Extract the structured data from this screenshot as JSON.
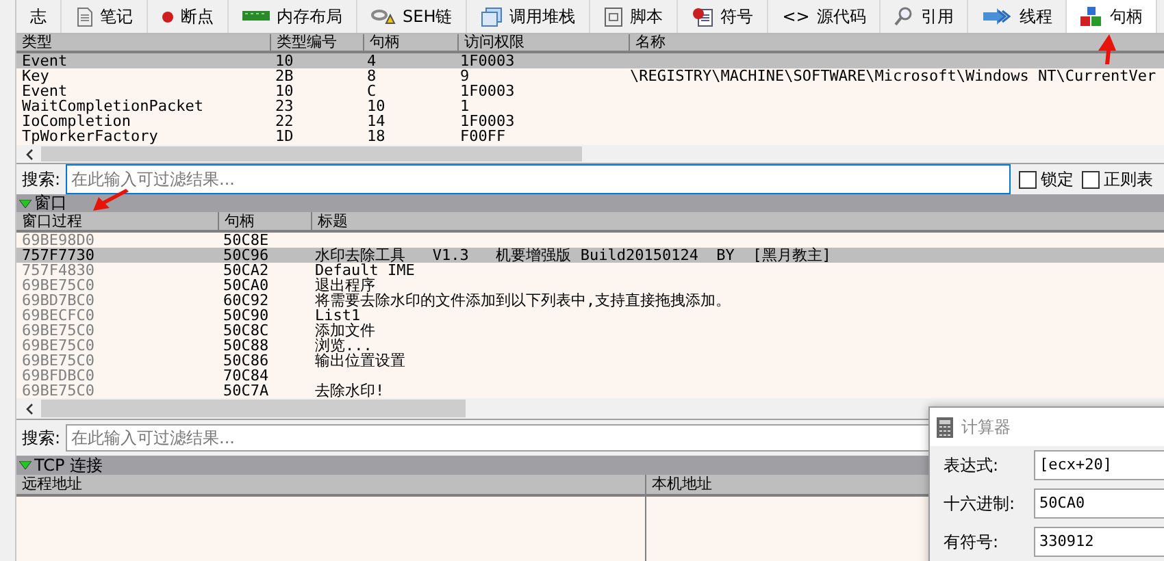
{
  "tabs": [
    {
      "label": "志",
      "kind": "none",
      "selected": false
    },
    {
      "label": "笔记",
      "kind": "note",
      "selected": false
    },
    {
      "label": "断点",
      "kind": "dot",
      "selected": false
    },
    {
      "label": "内存布局",
      "kind": "ram",
      "selected": false
    },
    {
      "label": "SEH链",
      "kind": "chain",
      "selected": false
    },
    {
      "label": "调用堆栈",
      "kind": "stack",
      "selected": false
    },
    {
      "label": "脚本",
      "kind": "script",
      "selected": false
    },
    {
      "label": "符号",
      "kind": "symbol",
      "selected": false
    },
    {
      "label": "<>",
      "kind": "text",
      "selected": false,
      "text": "源代码"
    },
    {
      "label": "引用",
      "kind": "search",
      "selected": false
    },
    {
      "label": "线程",
      "kind": "threads",
      "selected": false
    },
    {
      "label": "句柄",
      "kind": "blocks",
      "selected": true
    }
  ],
  "handles": {
    "columns": [
      "类型",
      "类型编号",
      "句柄",
      "访问权限",
      "名称"
    ],
    "rows": [
      {
        "cells": [
          "Event",
          "10",
          "4",
          "1F0003",
          ""
        ],
        "selected": true
      },
      {
        "cells": [
          "Key",
          "2B",
          "8",
          "9",
          "\\REGISTRY\\MACHINE\\SOFTWARE\\Microsoft\\Windows NT\\CurrentVer"
        ],
        "selected": false
      },
      {
        "cells": [
          "Event",
          "10",
          "C",
          "1F0003",
          ""
        ],
        "selected": false
      },
      {
        "cells": [
          "WaitCompletionPacket",
          "23",
          "10",
          "1",
          ""
        ],
        "selected": false
      },
      {
        "cells": [
          "IoCompletion",
          "22",
          "14",
          "1F0003",
          ""
        ],
        "selected": false
      },
      {
        "cells": [
          "TpWorkerFactory",
          "1D",
          "18",
          "F00FF",
          ""
        ],
        "selected": false
      }
    ]
  },
  "search_1": {
    "label": "搜索:",
    "placeholder": "在此输入可过滤结果...",
    "options": [
      {
        "label": "锁定",
        "checked": false
      },
      {
        "label": "正则表",
        "checked": false
      }
    ]
  },
  "windows": {
    "title": "窗口",
    "expanded": true,
    "columns": [
      "窗口过程",
      "句柄",
      "标题"
    ],
    "rows": [
      {
        "cells": [
          "69BE98D0",
          "50C8E",
          ""
        ],
        "selected": false
      },
      {
        "cells": [
          "757F7730",
          "50C96",
          "水印去除工具   V1.3   机要增强版 Build20150124  BY  [黑月教主]"
        ],
        "selected": true
      },
      {
        "cells": [
          "757F4830",
          "50CA2",
          "Default IME"
        ],
        "selected": false
      },
      {
        "cells": [
          "69BE75C0",
          "50CA0",
          "退出程序"
        ],
        "selected": false
      },
      {
        "cells": [
          "69BD7BC0",
          "60C92",
          "将需要去除水印的文件添加到以下列表中,支持直接拖拽添加。"
        ],
        "selected": false
      },
      {
        "cells": [
          "69BECFC0",
          "50C90",
          "List1"
        ],
        "selected": false
      },
      {
        "cells": [
          "69BE75C0",
          "50C8C",
          "添加文件"
        ],
        "selected": false
      },
      {
        "cells": [
          "69BE75C0",
          "50C88",
          "浏览..."
        ],
        "selected": false
      },
      {
        "cells": [
          "69BE75C0",
          "50C86",
          "输出位置设置"
        ],
        "selected": false
      },
      {
        "cells": [
          "69BFDBC0",
          "70C84",
          ""
        ],
        "selected": false
      },
      {
        "cells": [
          "69BE75C0",
          "50C7A",
          "去除水印!"
        ],
        "selected": false
      }
    ]
  },
  "search_2": {
    "label": "搜索:",
    "placeholder": "在此输入可过滤结果..."
  },
  "tcp": {
    "title": "TCP 连接",
    "expanded": true,
    "columns": [
      "远程地址",
      "本机地址"
    ]
  },
  "calculator": {
    "title": "计算器",
    "fields": [
      {
        "label": "表达式:",
        "value": "[ecx+20]"
      },
      {
        "label": "十六进制:",
        "value": "50CA0"
      },
      {
        "label": "有符号:",
        "value": "330912"
      }
    ]
  }
}
